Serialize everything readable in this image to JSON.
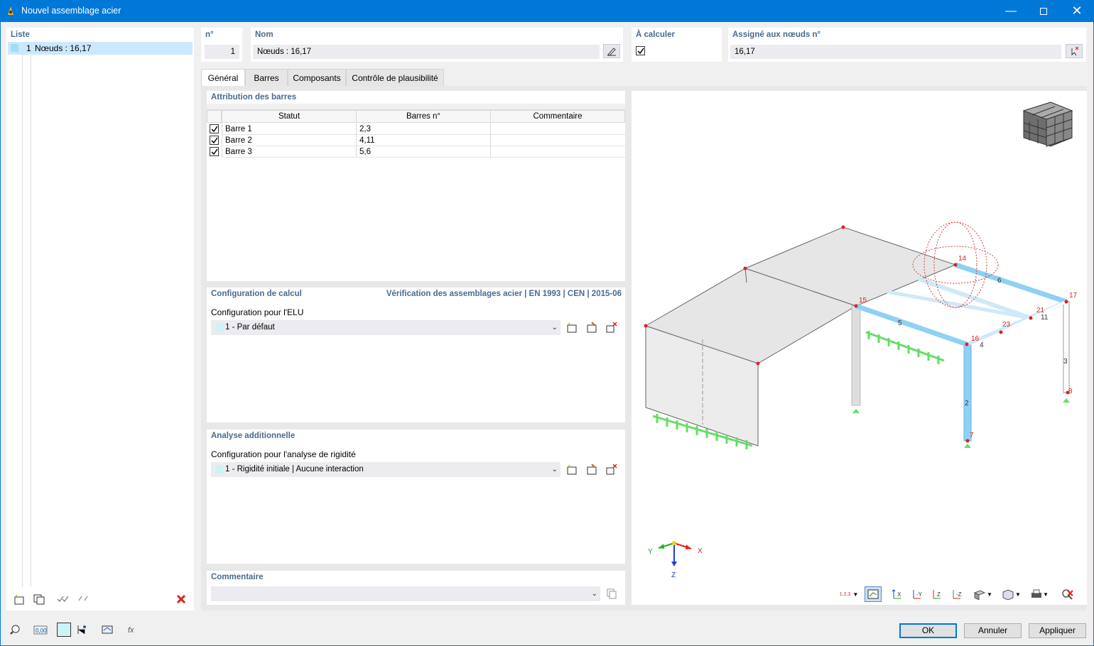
{
  "window": {
    "title": "Nouvel assemblage acier"
  },
  "list": {
    "label": "Liste",
    "items": [
      {
        "number": "1",
        "name": "Nœuds : 16,17"
      }
    ]
  },
  "header": {
    "no_label": "n°",
    "no_value": "1",
    "name_label": "Nom",
    "name_value": "Nœuds : 16,17",
    "calc_label": "À calculer",
    "calc_checked": true,
    "assigned_label": "Assigné aux nœuds n°",
    "assigned_value": "16,17"
  },
  "tabs": [
    "Général",
    "Barres",
    "Composants",
    "Contrôle de plausibilité"
  ],
  "members": {
    "section_title": "Attribution des barres",
    "columns": [
      "Statut",
      "Barres n°",
      "Commentaire"
    ],
    "rows": [
      {
        "status": "Barre 1",
        "members": "2,3",
        "comment": "",
        "checked": true
      },
      {
        "status": "Barre 2",
        "members": "4,11",
        "comment": "",
        "checked": true
      },
      {
        "status": "Barre 3",
        "members": "5,6",
        "comment": "",
        "checked": true
      }
    ]
  },
  "calc_config": {
    "section_title": "Configuration de calcul",
    "standard": "Vérification des assemblages acier | EN 1993 | CEN | 2015-06",
    "uls_label": "Configuration pour l'ELU",
    "uls_value": "1 - Par défaut"
  },
  "additional": {
    "section_title": "Analyse additionnelle",
    "stiffness_label": "Configuration pour l'analyse de rigidité",
    "stiffness_value": "1 - Rigidité initiale | Aucune interaction"
  },
  "comment": {
    "section_title": "Commentaire",
    "value": ""
  },
  "view": {
    "axes": {
      "x": "X",
      "y": "Y",
      "z": "Z"
    },
    "node_labels": [
      "14",
      "15",
      "16",
      "17",
      "21",
      "23",
      "7",
      "8"
    ],
    "member_labels": [
      "2",
      "3",
      "4",
      "5",
      "6",
      "11"
    ],
    "toolbar_numbering": "1.2.3"
  },
  "footer": {
    "ok": "OK",
    "cancel": "Annuler",
    "apply": "Appliquer"
  },
  "colors": {
    "accent": "#0078d7",
    "section_label": "#4a6b8c",
    "member_blue": "#8fd0f5",
    "node_red": "#e02020",
    "support_green": "#66dd66"
  }
}
